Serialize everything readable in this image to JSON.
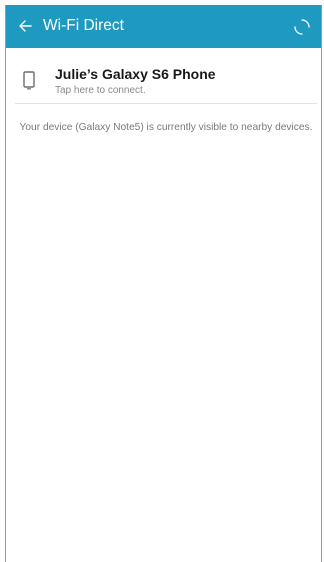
{
  "appbar": {
    "title": "Wi-Fi Direct",
    "background": "#1e9ac0",
    "back_icon": "arrow-left-icon",
    "refresh_icon": "refresh-icon"
  },
  "devices": [
    {
      "name": "Julie’s Galaxy S6 Phone",
      "subtitle": "Tap here to connect.",
      "icon": "phone-icon"
    }
  ],
  "visibility_note": "Your device (Galaxy Note5) is currently visible to nearby devices."
}
